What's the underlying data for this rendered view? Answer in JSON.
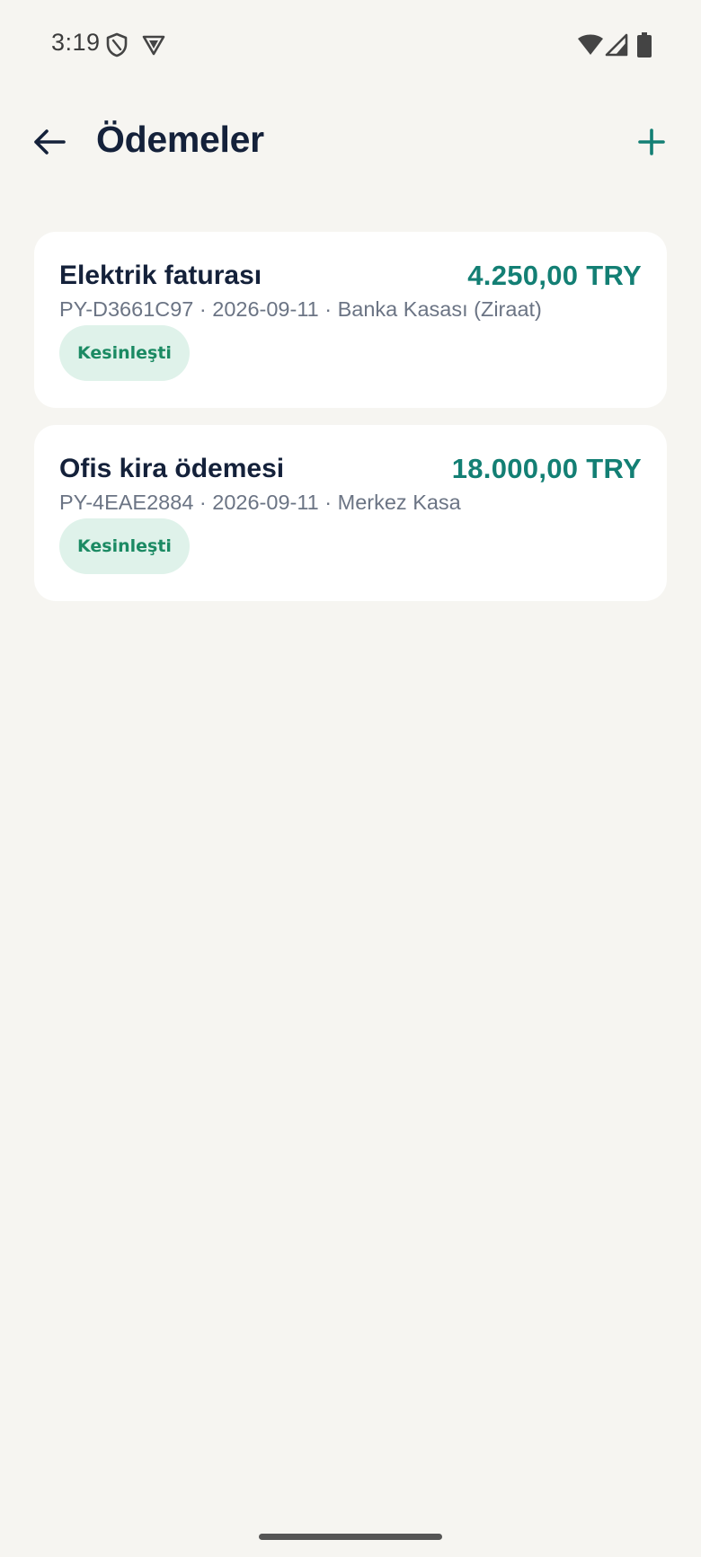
{
  "status_bar": {
    "time": "3:19",
    "left_icons": [
      "shield-icon",
      "vpn-badge-icon"
    ],
    "right_icons": [
      "wifi-icon",
      "signal-icon",
      "battery-icon"
    ]
  },
  "app_bar": {
    "title": "Ödemeler",
    "back_icon": "arrow-left-icon",
    "add_icon": "plus-icon"
  },
  "colors": {
    "background": "#f6f5f1",
    "card": "#ffffff",
    "title_text": "#14213a",
    "amount": "#137f74",
    "meta_text": "#6b7484",
    "badge_bg": "#dff2ea",
    "badge_text": "#1b8a63",
    "accent": "#137f74"
  },
  "payments": [
    {
      "title": "Elektrik faturası",
      "amount": "4.250,00 TRY",
      "meta": "PY-D3661C97 · 2026-09-11 · Banka Kasası (Ziraat)",
      "status": "Kesinleşti"
    },
    {
      "title": "Ofis kira ödemesi",
      "amount": "18.000,00 TRY",
      "meta": "PY-4EAE2884 · 2026-09-11 · Merkez Kasa",
      "status": "Kesinleşti"
    }
  ]
}
